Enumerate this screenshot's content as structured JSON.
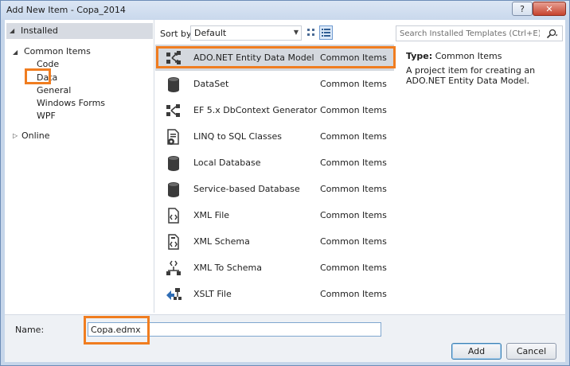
{
  "window": {
    "title": "Add New Item - Copa_2014",
    "help_label": "?",
    "close_label": "✕"
  },
  "colors": {
    "annotation": "#f07d20",
    "selection": "#d4d8de",
    "installed_header": "#d7dbe2"
  },
  "tree": {
    "installed": "Installed",
    "common_items": "Common Items",
    "children": [
      "Code",
      "Data",
      "General",
      "Windows Forms",
      "WPF"
    ],
    "online": "Online"
  },
  "toolbar": {
    "sort_label": "Sort by:",
    "sort_value": "Default",
    "search_placeholder": "Search Installed Templates (Ctrl+E)"
  },
  "templates": [
    {
      "name": "ADO.NET Entity Data Model",
      "category": "Common Items",
      "icon": "entity-model-icon",
      "selected": true
    },
    {
      "name": "DataSet",
      "category": "Common Items",
      "icon": "database-icon",
      "selected": false
    },
    {
      "name": "EF 5.x DbContext Generator",
      "category": "Common Items",
      "icon": "entity-generator-icon",
      "selected": false
    },
    {
      "name": "LINQ to SQL Classes",
      "category": "Common Items",
      "icon": "linq-document-icon",
      "selected": false
    },
    {
      "name": "Local Database",
      "category": "Common Items",
      "icon": "database-icon",
      "selected": false
    },
    {
      "name": "Service-based Database",
      "category": "Common Items",
      "icon": "database-icon",
      "selected": false
    },
    {
      "name": "XML File",
      "category": "Common Items",
      "icon": "xml-file-icon",
      "selected": false
    },
    {
      "name": "XML Schema",
      "category": "Common Items",
      "icon": "xml-schema-icon",
      "selected": false
    },
    {
      "name": "XML To Schema",
      "category": "Common Items",
      "icon": "xml-to-schema-icon",
      "selected": false
    },
    {
      "name": "XSLT File",
      "category": "Common Items",
      "icon": "xslt-file-icon",
      "selected": false
    }
  ],
  "info": {
    "type_label": "Type:",
    "type_value": "Common Items",
    "description": "A project item for creating an ADO.NET Entity Data Model."
  },
  "bottom": {
    "name_label": "Name:",
    "name_value": "Copa.edmx",
    "add_label": "Add",
    "cancel_label": "Cancel"
  }
}
